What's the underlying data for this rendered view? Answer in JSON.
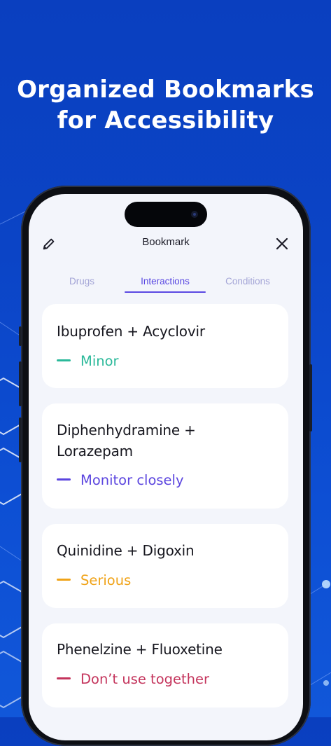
{
  "headline": {
    "line1": "Organized Bookmarks",
    "line2": "for Accessibility"
  },
  "topbar": {
    "title": "Bookmark",
    "edit_icon": "pencil-icon",
    "close_icon": "close-icon"
  },
  "tabs": [
    {
      "label": "Drugs",
      "active": false
    },
    {
      "label": "Interactions",
      "active": true
    },
    {
      "label": "Conditions",
      "active": false
    }
  ],
  "bookmarks": [
    {
      "title_line1": "Ibuprofen + Acyclovir",
      "title_line2": "",
      "severity": "Minor",
      "color": "#2bb99a"
    },
    {
      "title_line1": "Diphenhydramine +",
      "title_line2": "Lorazepam",
      "severity": "Monitor closely",
      "color": "#5b45df"
    },
    {
      "title_line1": "Quinidine + Digoxin",
      "title_line2": "",
      "severity": "Serious",
      "color": "#f0a318"
    },
    {
      "title_line1": "Phenelzine + Fluoxetine",
      "title_line2": "",
      "severity": "Don’t use together",
      "color": "#c4345c"
    }
  ],
  "colors": {
    "background": "#0b44c6",
    "accent": "#5a49e2",
    "tab_inactive": "#a3a4d6"
  }
}
